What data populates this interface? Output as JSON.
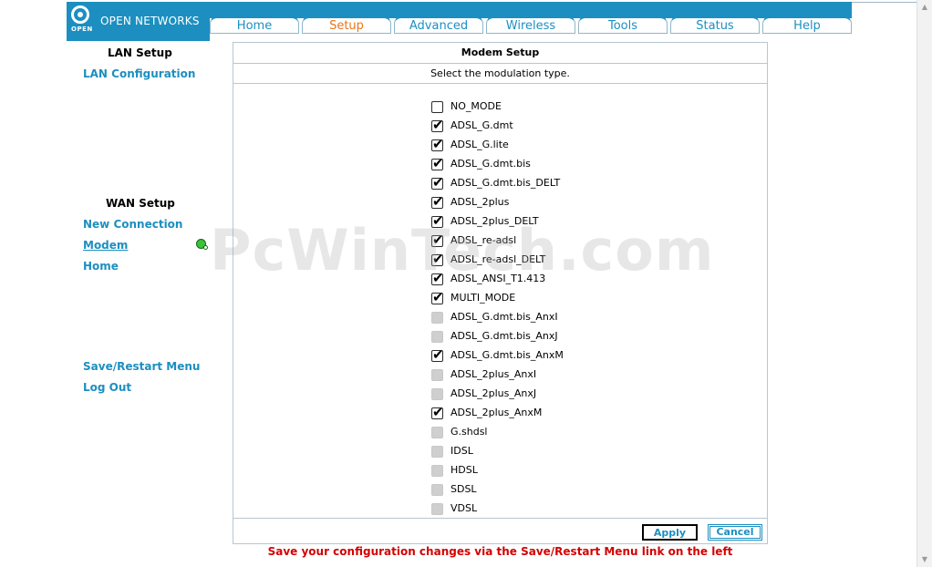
{
  "brand": {
    "name": "OPEN NETWORKS",
    "mark_text": "OPEN"
  },
  "tabs": [
    {
      "label": "Home",
      "active": false
    },
    {
      "label": "Setup",
      "active": true
    },
    {
      "label": "Advanced",
      "active": false
    },
    {
      "label": "Wireless",
      "active": false
    },
    {
      "label": "Tools",
      "active": false
    },
    {
      "label": "Status",
      "active": false
    },
    {
      "label": "Help",
      "active": false
    }
  ],
  "sidebar": {
    "lan_heading": "LAN Setup",
    "lan_configuration": "LAN Configuration",
    "wan_heading": "WAN Setup",
    "new_connection": "New Connection",
    "modem": "Modem",
    "home": "Home",
    "save_restart": "Save/Restart Menu",
    "logout": "Log Out"
  },
  "panel": {
    "title": "Modem Setup",
    "subtitle": "Select the modulation type.",
    "modes": [
      {
        "label": "NO_MODE",
        "checked": false,
        "disabled": false
      },
      {
        "label": "ADSL_G.dmt",
        "checked": true,
        "disabled": false
      },
      {
        "label": "ADSL_G.lite",
        "checked": true,
        "disabled": false
      },
      {
        "label": "ADSL_G.dmt.bis",
        "checked": true,
        "disabled": false
      },
      {
        "label": "ADSL_G.dmt.bis_DELT",
        "checked": true,
        "disabled": false
      },
      {
        "label": "ADSL_2plus",
        "checked": true,
        "disabled": false
      },
      {
        "label": "ADSL_2plus_DELT",
        "checked": true,
        "disabled": false
      },
      {
        "label": "ADSL_re-adsl",
        "checked": true,
        "disabled": false
      },
      {
        "label": "ADSL_re-adsl_DELT",
        "checked": true,
        "disabled": false
      },
      {
        "label": "ADSL_ANSI_T1.413",
        "checked": true,
        "disabled": false
      },
      {
        "label": "MULTI_MODE",
        "checked": true,
        "disabled": false
      },
      {
        "label": "ADSL_G.dmt.bis_AnxI",
        "checked": false,
        "disabled": true
      },
      {
        "label": "ADSL_G.dmt.bis_AnxJ",
        "checked": false,
        "disabled": true
      },
      {
        "label": "ADSL_G.dmt.bis_AnxM",
        "checked": true,
        "disabled": false
      },
      {
        "label": "ADSL_2plus_AnxI",
        "checked": false,
        "disabled": true
      },
      {
        "label": "ADSL_2plus_AnxJ",
        "checked": false,
        "disabled": true
      },
      {
        "label": "ADSL_2plus_AnxM",
        "checked": true,
        "disabled": false
      },
      {
        "label": "G.shdsl",
        "checked": false,
        "disabled": true
      },
      {
        "label": "IDSL",
        "checked": false,
        "disabled": true
      },
      {
        "label": "HDSL",
        "checked": false,
        "disabled": true
      },
      {
        "label": "SDSL",
        "checked": false,
        "disabled": true
      },
      {
        "label": "VDSL",
        "checked": false,
        "disabled": true
      }
    ],
    "apply_label": "Apply",
    "cancel_label": "Cancel"
  },
  "notice": "Save your configuration changes via the Save/Restart Menu link on the left",
  "watermark": "PcWinTech.com",
  "colors": {
    "brand": "#1c8fc0",
    "active_tab": "#e8761a",
    "notice": "#d40000"
  }
}
